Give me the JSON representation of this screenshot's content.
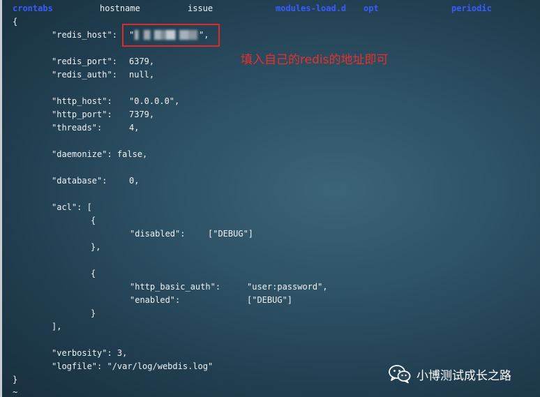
{
  "listing": {
    "crontabs": "crontabs",
    "hostname": "hostname",
    "issue": "issue",
    "modules_load": "modules-load.d",
    "opt": "opt",
    "periodic": "periodic"
  },
  "config": {
    "open_brace": "{",
    "redis_host_key": "\"redis_host\":",
    "redis_host_quote_open": "\"",
    "redis_host_quote_close": "\",",
    "redis_port_key": "\"redis_port\":",
    "redis_port_val": "6379,",
    "redis_auth_key": "\"redis_auth\":",
    "redis_auth_val": "null,",
    "http_host_key": "\"http_host\":",
    "http_host_val": "\"0.0.0.0\",",
    "http_port_key": "\"http_port\":",
    "http_port_val": "7379,",
    "threads_key": "\"threads\":",
    "threads_val": "4,",
    "daemonize": "\"daemonize\": false,",
    "database_key": "\"database\":",
    "database_val": "0,",
    "acl_open": "\"acl\": [",
    "obj1_open": "{",
    "disabled_key": "\"disabled\":",
    "disabled_val": "[\"DEBUG\"]",
    "obj1_close": "},",
    "obj2_open": "{",
    "basic_auth_key": "\"http_basic_auth\":",
    "basic_auth_val": "\"user:password\",",
    "enabled_key": "\"enabled\":",
    "enabled_val": "[\"DEBUG\"]",
    "obj2_close": "}",
    "acl_close": "],",
    "verbosity": "\"verbosity\": 3,",
    "logfile": "\"logfile\": \"/var/log/webdis.log\"",
    "close_brace": "}",
    "tilde": "~"
  },
  "annotation": {
    "text": "填入自己的redis的地址即可",
    "color": "#e8302c"
  },
  "watermark": {
    "icon": "wechat-icon",
    "text": "小博测试成长之路"
  },
  "colors": {
    "directory": "#3a5cff",
    "highlight_box": "#e02a2a",
    "text": "#f0f2f4"
  }
}
